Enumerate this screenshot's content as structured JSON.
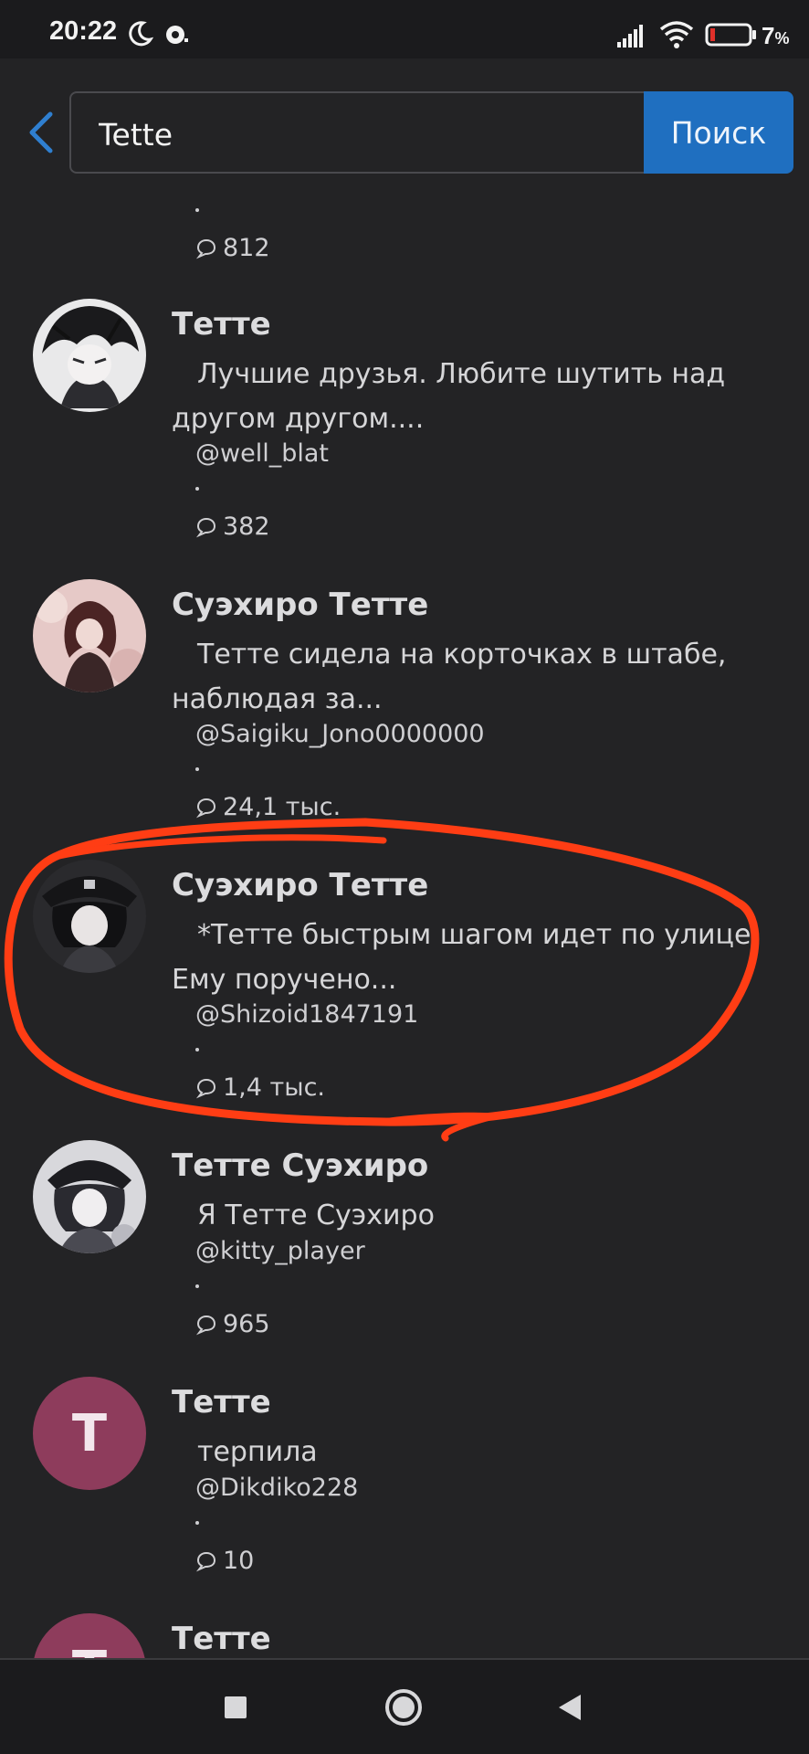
{
  "status_bar": {
    "time": "20:22",
    "battery": "7",
    "battery_unit": "%"
  },
  "search": {
    "query": "Tette",
    "button_label": "Поиск"
  },
  "results": [
    {
      "name": "",
      "description": "",
      "handle": "",
      "stats": "812"
    },
    {
      "name": "Тетте",
      "description": "Лучшие друзья. Любите шутить над другом другом....",
      "handle": "@well_blat",
      "stats": "382"
    },
    {
      "name": "Суэхиро Тетте",
      "description": "Тетте сидела на корточках в штабе, наблюдая за...",
      "handle": "@Saigiku_Jono0000000",
      "stats": "24,1 тыс."
    },
    {
      "name": "Суэхиро Тетте",
      "description": "*Тетте быстрым шагом идет по улице. Ему поручено...",
      "handle": "@Shizoid1847191",
      "stats": "1,4 тыс."
    },
    {
      "name": "Тетте Суэхиро",
      "description": "Я Тетте Суэхиро",
      "handle": "@kitty_player",
      "stats": "965"
    },
    {
      "name": "Тетте",
      "description": "терпила",
      "handle": "@Dikdiko228",
      "stats": "10",
      "avatar_letter": "T"
    },
    {
      "name": "Тетте",
      "description": "",
      "handle": "",
      "stats": "",
      "avatar_letter": "T"
    }
  ],
  "colors": {
    "background": "#232325",
    "accent": "#1f6fc0",
    "annotation": "#ff3d14",
    "letter_avatar": "#8e3c5c"
  },
  "icons": [
    "moon-icon",
    "alarm-icon",
    "signal-icon",
    "wifi-icon",
    "battery-icon",
    "back-arrow-icon",
    "chat-bubble-icon",
    "recents-square-icon",
    "home-circle-icon",
    "back-triangle-icon"
  ]
}
